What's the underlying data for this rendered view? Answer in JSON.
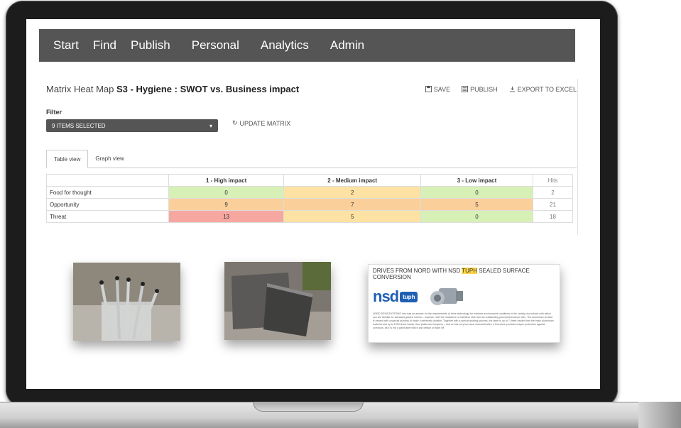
{
  "nav": {
    "items": [
      "Start",
      "Find",
      "Publish",
      "Personal",
      "Analytics",
      "Admin"
    ]
  },
  "header": {
    "title_prefix": "Matrix Heat Map",
    "title_bold": "S3 - Hygiene : SWOT vs. Business impact"
  },
  "toolbar": {
    "save_label": "SAVE",
    "publish_label": "PUBLISH",
    "export_label": "EXPORT TO EXCEL"
  },
  "filter": {
    "label": "Filter",
    "selected": "9 ITEMS SELECTED",
    "update_label": "UPDATE MATRIX"
  },
  "tabs": [
    "Table view",
    "Graph view"
  ],
  "matrix": {
    "columns": [
      "1 - High impact",
      "2 - Medium impact",
      "3 - Low impact",
      "Hits"
    ],
    "rows": [
      {
        "label": "Food for thought",
        "values": [
          "0",
          "2",
          "0"
        ],
        "hits": "2"
      },
      {
        "label": "Opportunity",
        "values": [
          "9",
          "7",
          "5"
        ],
        "hits": "21"
      },
      {
        "label": "Threat",
        "values": [
          "13",
          "5",
          "0"
        ],
        "hits": "18"
      }
    ],
    "colors": {
      "green": "#d6f0b6",
      "orange": "#fbcf9a",
      "yellow": "#fde2a3",
      "red": "#f6a8a0"
    }
  },
  "document": {
    "title_part1": "DRIVES FROM NORD WITH NSD",
    "title_highlight": "TUPH",
    "title_part2": "SEALED SURFACE CONVERSION",
    "logo_text": "nsd",
    "logo_badge": "tuph",
    "body": "NORD DRIVESYSTEMS now has an answer for the requirements of drive technology for extreme environment conditions in the variety of products with which you are familiar for standard geared motors – however, with the resistance of stainless steel and an outstanding price/performance ratio. The aluminium surface is treated with a special process to make it extremely durable. Together with a special sealing process, the layer is up to 7 times harder than the basic aluminium material and up to 1000 times harder than paints and lacquers – and so has very low wear characteristics. It therefore provides unique protection against corrosion, as it is not a paint layer which can detach or flake off."
  }
}
